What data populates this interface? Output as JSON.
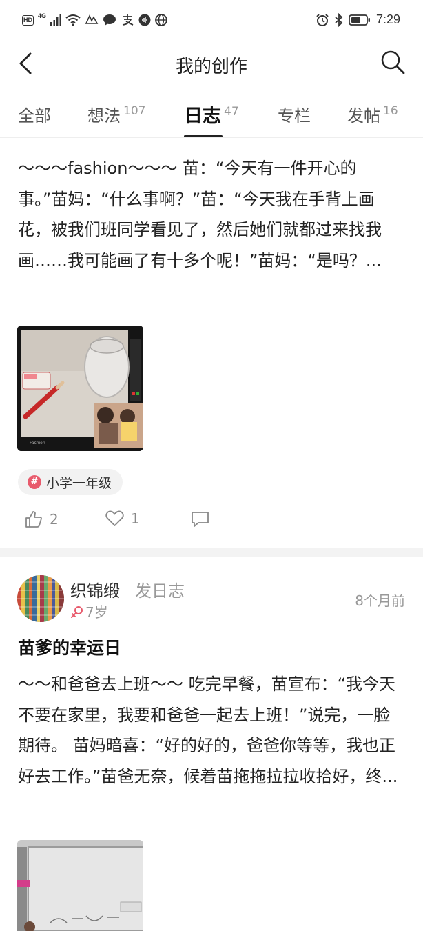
{
  "status_bar": {
    "hd": "HD",
    "network": "4G",
    "wifi_badge": "6",
    "time": "7:29",
    "left_icons": [
      "signal-icon",
      "wifi-icon",
      "app-notification-icon",
      "chat-icon",
      "alipay-icon",
      "music-icon",
      "browser-icon"
    ],
    "right_icons": [
      "alarm-icon",
      "bluetooth-icon",
      "battery-icon"
    ]
  },
  "header": {
    "title": "我的创作",
    "back_icon": "chevron-left-icon",
    "search_icon": "search-icon"
  },
  "tabs": [
    {
      "label": "全部",
      "count": ""
    },
    {
      "label": "想法",
      "count": "107"
    },
    {
      "label": "日志",
      "count": "47",
      "active": true
    },
    {
      "label": "专栏",
      "count": ""
    },
    {
      "label": "发帖",
      "count": "16"
    }
  ],
  "post1": {
    "excerpt": "～～～fashion～～～ 苗：“今天有一件开心的事。”苗妈：“什么事啊？”苗：“今天我在手背上画花，被我们班同学看见了，然后她们就都过来找我画……我可能画了有十多个呢！”苗妈：“是吗？...",
    "image_caption": "Fashion",
    "image_icon": "photo-collage-icon",
    "tag": "小学一年级",
    "tag_icon": "hashtag-icon",
    "likes": "2",
    "favorites": "1",
    "like_icon": "thumbs-up-icon",
    "favorite_icon": "heart-icon",
    "comment_icon": "comment-icon"
  },
  "post2": {
    "author": "织锦缎",
    "action": "发日志",
    "age": "7岁",
    "gender_icon": "female-icon",
    "time_ago": "8个月前",
    "title": "苗爹的幸运日",
    "excerpt": "～～和爸爸去上班～～ 吃完早餐，苗宣布：“我今天不要在家里，我要和爸爸一起去上班！”说完，一脸期待。 苗妈暗喜：“好的好的，爸爸你等等，我也正好去工作。”苗爸无奈，候着苗拖拖拉拉收拾好，终...",
    "image_icon": "whiteboard-photo-icon"
  },
  "colors": {
    "accent_tag": "#e85a6c",
    "female": "#e85a6c",
    "text_primary": "#222222",
    "text_secondary": "#999999"
  }
}
